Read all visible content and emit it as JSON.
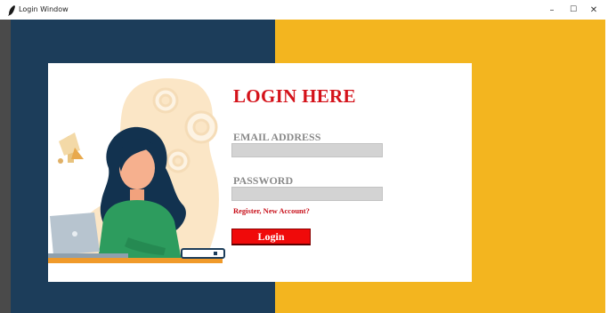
{
  "window": {
    "title": "Login Window",
    "icon": "feather-icon",
    "controls": {
      "minimize": "–",
      "maximize": "☐",
      "close": "✕"
    }
  },
  "colors": {
    "left_panel": "#1c3d5a",
    "right_panel": "#f3b51f",
    "title_red": "#d4121a",
    "button_red": "#f00a0a",
    "input_gray": "#d3d3d3"
  },
  "form": {
    "title": "LOGIN HERE",
    "email_label": "EMAIL ADDRESS",
    "email_value": "",
    "password_label": "PASSWORD",
    "password_value": "",
    "register_link": "Register, New Account?",
    "login_button": "Login"
  },
  "illustration": {
    "description_icon": "woman-with-laptop-illustration"
  }
}
